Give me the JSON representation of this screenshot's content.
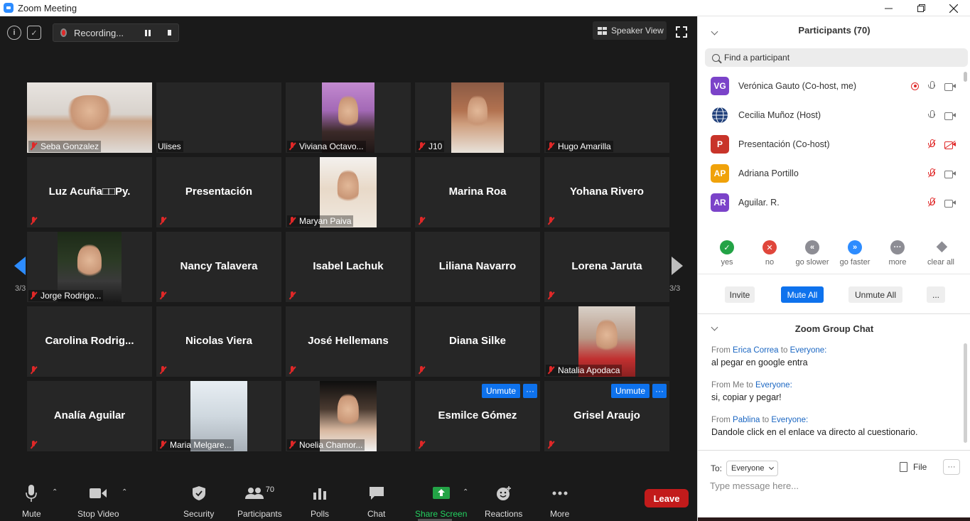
{
  "window": {
    "title": "Zoom Meeting"
  },
  "meeting": {
    "recording_label": "Recording...",
    "speaker_view_label": "Speaker View",
    "page_indicator": "3/3",
    "tiles": [
      {
        "name": "Seba Gonzalez",
        "kind": "photo",
        "muted": true
      },
      {
        "name": "Ulises",
        "kind": "label-only",
        "muted": false
      },
      {
        "name": "Viviana Octavo...",
        "kind": "photo",
        "muted": true
      },
      {
        "name": "J10",
        "kind": "photo",
        "muted": true
      },
      {
        "name": "Hugo Amarilla",
        "kind": "label-only",
        "muted": true
      },
      {
        "name": "Luz Acuña□□Py.",
        "kind": "center",
        "muted": true
      },
      {
        "name": "Presentación",
        "kind": "center",
        "muted": true
      },
      {
        "name": "Maryan Paiva",
        "kind": "photo",
        "muted": true
      },
      {
        "name": "Marina Roa",
        "kind": "center",
        "muted": true
      },
      {
        "name": "Yohana Rivero",
        "kind": "center",
        "muted": true
      },
      {
        "name": "Jorge Rodrigo...",
        "kind": "photo",
        "muted": true
      },
      {
        "name": "Nancy Talavera",
        "kind": "center",
        "muted": true
      },
      {
        "name": "Isabel Lachuk",
        "kind": "center",
        "muted": true
      },
      {
        "name": "Liliana Navarro",
        "kind": "center",
        "muted": false
      },
      {
        "name": "Lorena Jaruta",
        "kind": "center",
        "muted": true
      },
      {
        "name": "Carolina  Rodrig...",
        "kind": "center",
        "muted": true
      },
      {
        "name": "Nicolas Viera",
        "kind": "center",
        "muted": true
      },
      {
        "name": "José Hellemans",
        "kind": "center",
        "muted": true
      },
      {
        "name": "Diana Silke",
        "kind": "center",
        "muted": true
      },
      {
        "name": "Natalia Apodaca",
        "kind": "photo",
        "muted": true
      },
      {
        "name": "Analía Aguilar",
        "kind": "center",
        "muted": true
      },
      {
        "name": "Maria Melgare...",
        "kind": "photo",
        "muted": true
      },
      {
        "name": "Noelia Chamor...",
        "kind": "photo",
        "muted": true
      },
      {
        "name": "Esmilce Gómez",
        "kind": "center",
        "muted": true,
        "unmute": true
      },
      {
        "name": "Grisel Araujo",
        "kind": "center",
        "muted": true,
        "unmute": true
      }
    ],
    "unmute_label": "Unmute",
    "more_dots": "···"
  },
  "toolbar": {
    "mute": "Mute",
    "stop_video": "Stop Video",
    "security": "Security",
    "participants": "Participants",
    "participants_count": "70",
    "polls": "Polls",
    "chat": "Chat",
    "share_screen": "Share Screen",
    "reactions": "Reactions",
    "more": "More",
    "leave": "Leave"
  },
  "participants_panel": {
    "title": "Participants (70)",
    "search_placeholder": "Find a participant",
    "rows": [
      {
        "initials": "VG",
        "color": "#7b43c9",
        "name": "Verónica Gauto  (Co-host, me)"
      },
      {
        "initials": "",
        "color": "#ffffff",
        "name": "Cecilia Muñoz (Host)"
      },
      {
        "initials": "P",
        "color": "#c8342a",
        "name": "Presentación (Co-host)"
      },
      {
        "initials": "AP",
        "color": "#f0a20a",
        "name": "Adriana Portillo"
      },
      {
        "initials": "AR",
        "color": "#7b43c9",
        "name": "Aguilar. R."
      }
    ],
    "reactions": [
      {
        "label": "yes",
        "color": "#23a346"
      },
      {
        "label": "no",
        "color": "#e0463b"
      },
      {
        "label": "go slower",
        "color": "#8d8d94"
      },
      {
        "label": "go faster",
        "color": "#2d8cff"
      },
      {
        "label": "more",
        "color": "#8d8d94"
      },
      {
        "label": "clear all",
        "color": "#8d8d94"
      }
    ],
    "invite": "Invite",
    "mute_all": "Mute All",
    "unmute_all": "Unmute All",
    "more": "..."
  },
  "chat": {
    "title": "Zoom Group Chat",
    "from_word": "From",
    "to_word": "to",
    "messages": [
      {
        "from": "Erica Correa",
        "to": "Everyone:",
        "text": "al pegar en google entra"
      },
      {
        "from": "Me",
        "to": "Everyone:",
        "text": "si, copiar y pegar!"
      },
      {
        "from": "Pablina",
        "to": "Everyone:",
        "text": "Dandole click en el enlace va directo al cuestionario."
      }
    ],
    "to_label": "To:",
    "recipient": "Everyone",
    "file": "File",
    "more": "···",
    "input_placeholder": "Type message here..."
  }
}
